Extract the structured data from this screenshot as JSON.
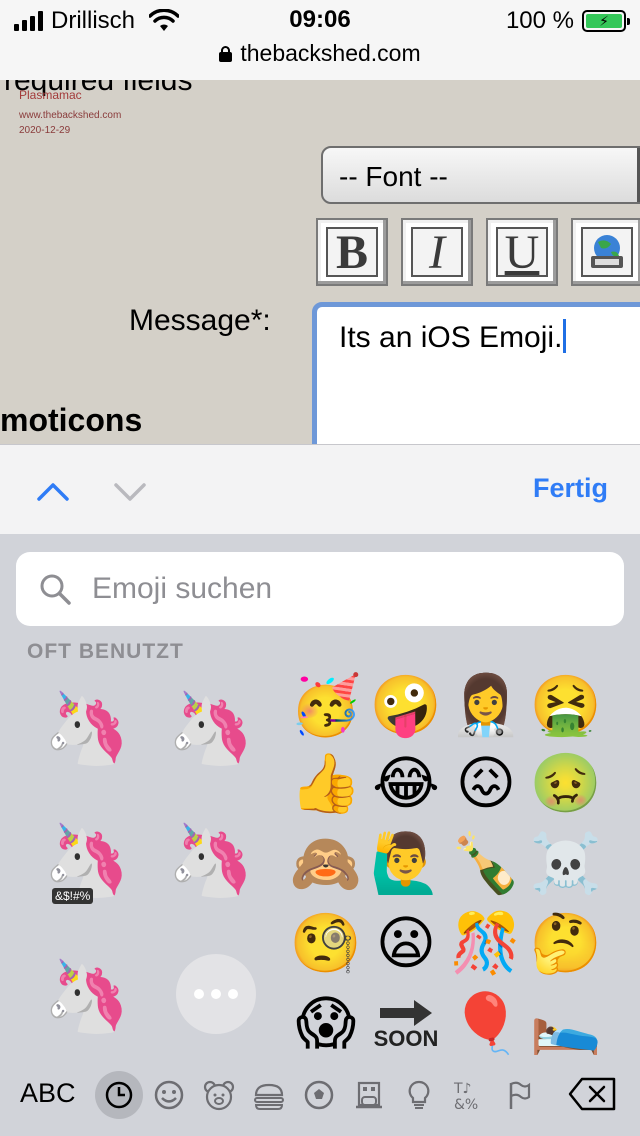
{
  "status_bar": {
    "carrier": "Drillisch",
    "time": "09:06",
    "battery_percent": "100 %",
    "url": "thebackshed.com"
  },
  "page": {
    "required_text": "required fields",
    "watermark": {
      "name": "Plasmamac",
      "site": "www.thebackshed.com",
      "date": "2020-12-29"
    },
    "font_select": "-- Font --",
    "format_buttons": [
      "B",
      "I",
      "U"
    ],
    "message_label": "Message*:",
    "message_value": "Its an iOS Emoji.",
    "emoticons_heading": "moticons"
  },
  "accessory": {
    "done_label": "Fertig"
  },
  "keyboard": {
    "search_placeholder": "Emoji suchen",
    "section_label": "OFT BENUTZT",
    "memoji_tag": "&$!#%",
    "emoji_grid": [
      [
        "🥳",
        "🤪",
        "👩‍⚕️",
        "🤮"
      ],
      [
        "👍",
        "😂",
        "😖",
        "🤢"
      ],
      [
        "🙈",
        "🙋‍♂️",
        "🍾",
        "☠️"
      ],
      [
        "🧐",
        "😦",
        "🎊",
        "🤔"
      ],
      [
        "😱",
        "🔜",
        "🎈",
        "🛌"
      ]
    ],
    "soon_label": "SOON",
    "abc_label": "ABC",
    "categories": [
      "clock-icon",
      "smiley-icon",
      "bear-icon",
      "food-icon",
      "ball-icon",
      "building-icon",
      "bulb-icon",
      "symbols-icon",
      "flag-icon"
    ]
  }
}
